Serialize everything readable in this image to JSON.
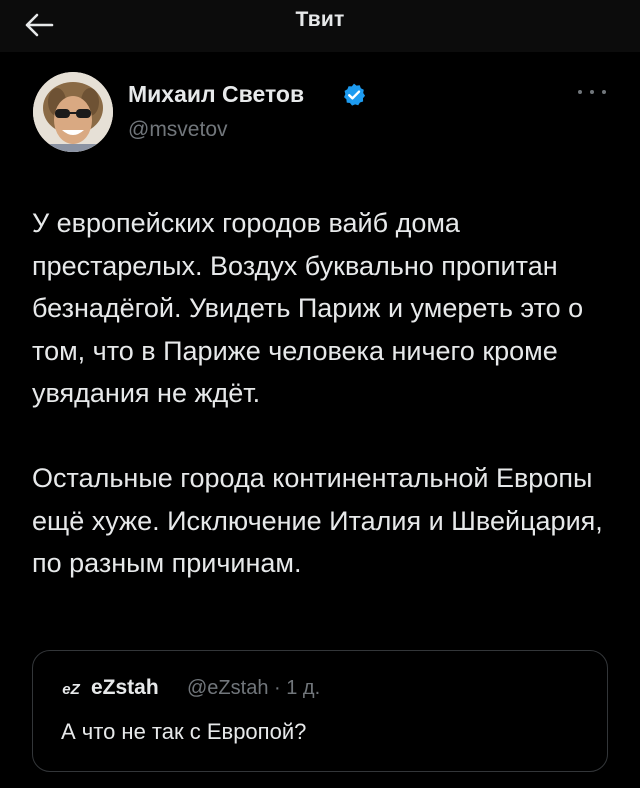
{
  "header": {
    "title": "Твит",
    "back_icon": "arrow-left-icon"
  },
  "author": {
    "name": "Михаил Светов",
    "handle": "@msvetov",
    "verified": true,
    "avatar": "avatar-photo"
  },
  "tweet": {
    "paragraphs": [
      "У европейских городов вайб дома престарелых. Воздух буквально пропитан безнадёгой. Увидеть Париж и умереть это о том, что в Париже человека ничего кроме увядания не ждёт.",
      "Остальные города континентальной Европы ещё хуже. Исключение Италия и Швейцария, по разным причинам."
    ]
  },
  "quote": {
    "logo": "eZ",
    "name": "eZstah",
    "handle": "@eZstah",
    "meta": "@eZstah · 1 д.",
    "text": "А что не так с Европой?"
  },
  "colors": {
    "background": "#000000",
    "text": "#e7e9ea",
    "muted": "#71767b",
    "verified": "#1d9bf0",
    "border": "#333639"
  }
}
